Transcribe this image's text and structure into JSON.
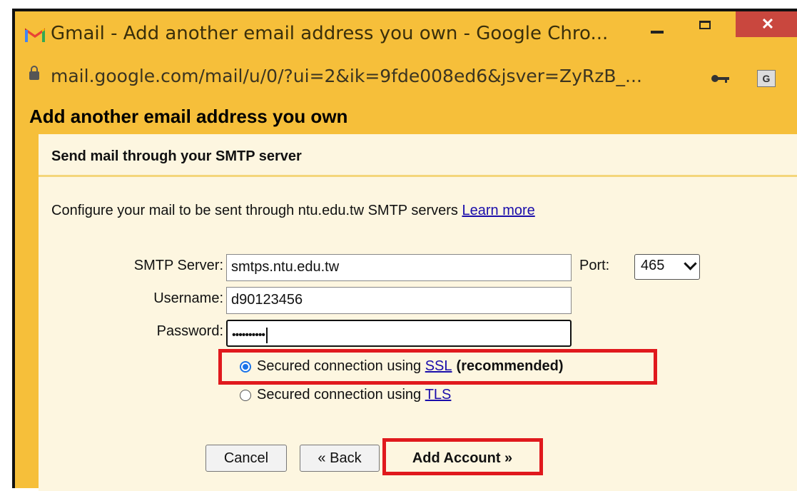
{
  "window": {
    "title": "Gmail - Add another email address you own - Google Chro...",
    "url": "mail.google.com/mail/u/0/?ui=2&ik=9fde008ed6&jsver=ZyRzB_...",
    "close_glyph": "✕"
  },
  "dialog": {
    "title": "Add another email address you own",
    "section_title": "Send mail through your SMTP server",
    "description": "Configure your mail to be sent through ntu.edu.tw SMTP servers",
    "learn_more": "Learn more"
  },
  "form": {
    "smtp_label": "SMTP Server:",
    "smtp_value": "smtps.ntu.edu.tw",
    "port_label": "Port:",
    "port_value": "465",
    "username_label": "Username:",
    "username_value": "d90123456",
    "password_label": "Password:",
    "password_value": "••••••••••"
  },
  "security": {
    "ssl_prefix": "Secured connection using ",
    "ssl_link": "SSL",
    "ssl_suffix": "(recommended)",
    "ssl_selected": true,
    "tls_prefix": "Secured connection using ",
    "tls_link": "TLS",
    "tls_selected": false
  },
  "buttons": {
    "cancel": "Cancel",
    "back": "« Back",
    "add_account": "Add Account »"
  },
  "colors": {
    "chrome_bg": "#f6bf3a",
    "panel_bg": "#fdf6e0",
    "highlight": "#e0191d",
    "link": "#1a0dab"
  }
}
